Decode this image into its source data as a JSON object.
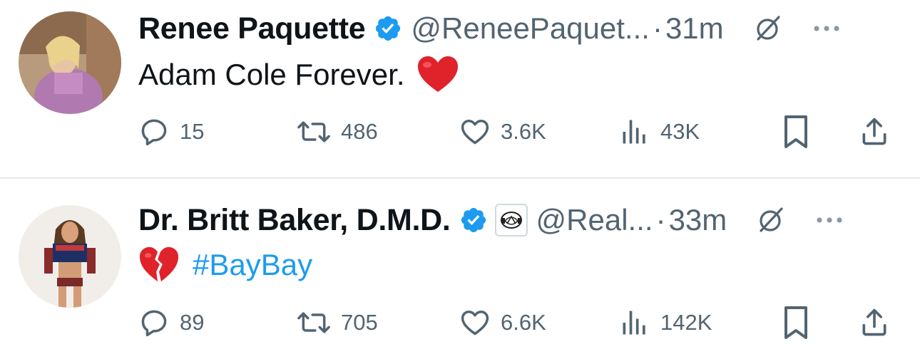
{
  "tweets": [
    {
      "author_name": "Renee Paquette",
      "handle": "@ReneePaquet...",
      "separator": "·",
      "time": "31m",
      "text": "Adam Cole Forever.",
      "emoji": "red-heart",
      "verified": true,
      "affiliate_badge": false,
      "metrics": {
        "replies": "15",
        "reposts": "486",
        "likes": "3.6K",
        "views": "43K"
      }
    },
    {
      "author_name": "Dr. Britt Baker, D.M.D.",
      "handle": "@Real...",
      "separator": "·",
      "time": "33m",
      "text": "",
      "emoji": "broken-heart",
      "hashtag": "#BayBay",
      "verified": true,
      "affiliate_badge": true,
      "metrics": {
        "replies": "89",
        "reposts": "705",
        "likes": "6.6K",
        "views": "142K"
      }
    }
  ],
  "colors": {
    "text_primary": "#0f1419",
    "text_secondary": "#536471",
    "verified_blue": "#1d9bf0",
    "hashtag_blue": "#1d9bf0",
    "divider": "#e6e9ec"
  },
  "icons": [
    "verified-badge-icon",
    "grok-icon",
    "more-icon",
    "reply-icon",
    "repost-icon",
    "like-icon",
    "views-icon",
    "bookmark-icon",
    "share-icon",
    "affiliate-badge-icon"
  ]
}
